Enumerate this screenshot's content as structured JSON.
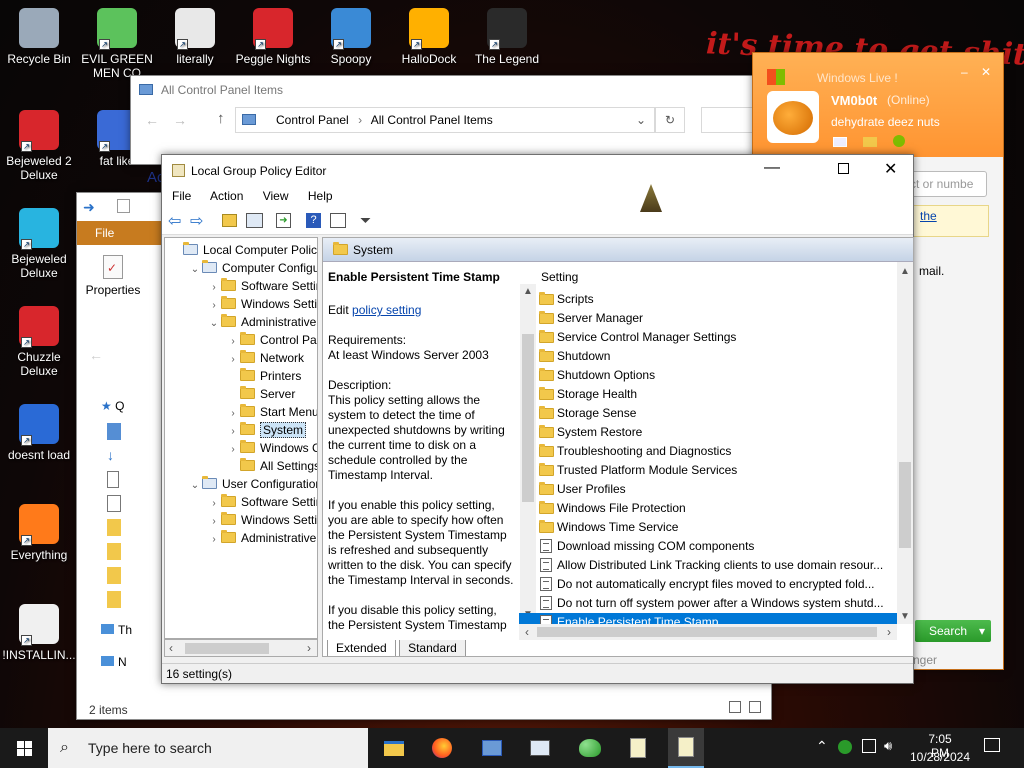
{
  "desktop": {
    "icons": [
      {
        "label": "Recycle Bin",
        "icon": "recycle-bin-icon"
      },
      {
        "label": "EVIL GREEN MEN CO",
        "icon": "green-men-icon"
      },
      {
        "label": "literally",
        "icon": "chrome-icon"
      },
      {
        "label": "Peggle Nights",
        "icon": "peggle-icon"
      },
      {
        "label": "Spoopy",
        "icon": "computers-icon"
      },
      {
        "label": "HalloDock",
        "icon": "hallodock-icon"
      },
      {
        "label": "The Legend",
        "icon": "legend-icon"
      },
      {
        "label": "Bejeweled 2 Deluxe",
        "icon": "bejeweled2-icon"
      },
      {
        "label": "fat like",
        "icon": "thunderbird-icon"
      },
      {
        "label": "Bejeweled Deluxe",
        "icon": "bejeweled-icon"
      },
      {
        "label": "Chuzzle Deluxe",
        "icon": "chuzzle-icon"
      },
      {
        "label": "doesnt load",
        "icon": "thunderbird-icon"
      },
      {
        "label": "Everything",
        "icon": "search-ring-icon"
      },
      {
        "label": "!INSTALLIN...",
        "icon": "text-file-icon"
      }
    ],
    "banner_text": "it's time to get shit"
  },
  "control_panel": {
    "title": "All Control Panel Items",
    "breadcrumb": [
      "Control Panel",
      "All Control Panel Items"
    ],
    "ac_text": "Ac"
  },
  "explorer": {
    "tab": "File",
    "ribbon_button": "Properties",
    "items_count": "2 items",
    "nav_q": "Q",
    "nav_th": "Th",
    "nav_n": "N"
  },
  "messenger": {
    "title": "Windows Live !",
    "user": "VM0b0t",
    "status": "(Online)",
    "mood": "dehydrate deez nuts",
    "search_placeholder": "ct or numbe",
    "link": "the",
    "mail": "mail.",
    "search_btn": "Search",
    "footer": "nger"
  },
  "gpedit": {
    "title": "Local Group Policy Editor",
    "menu": [
      "File",
      "Action",
      "View",
      "Help"
    ],
    "tree": [
      {
        "label": "Local Computer Policy",
        "level": 0,
        "arrow": ""
      },
      {
        "label": "Computer Configura",
        "level": 1,
        "arrow": "v"
      },
      {
        "label": "Software Settings",
        "level": 2,
        "arrow": ">"
      },
      {
        "label": "Windows Setting",
        "level": 2,
        "arrow": ">"
      },
      {
        "label": "Administrative Te",
        "level": 2,
        "arrow": "v"
      },
      {
        "label": "Control Panel",
        "level": 3,
        "arrow": ">"
      },
      {
        "label": "Network",
        "level": 3,
        "arrow": ">"
      },
      {
        "label": "Printers",
        "level": 3,
        "arrow": ""
      },
      {
        "label": "Server",
        "level": 3,
        "arrow": ""
      },
      {
        "label": "Start Menu ar",
        "level": 3,
        "arrow": ">"
      },
      {
        "label": "System",
        "level": 3,
        "arrow": ">",
        "selected": true
      },
      {
        "label": "Windows Cor",
        "level": 3,
        "arrow": ">"
      },
      {
        "label": "All Settings",
        "level": 3,
        "arrow": ""
      },
      {
        "label": "User Configuration",
        "level": 1,
        "arrow": "v"
      },
      {
        "label": "Software Settings",
        "level": 2,
        "arrow": ">"
      },
      {
        "label": "Windows Setting",
        "level": 2,
        "arrow": ">"
      },
      {
        "label": "Administrative Te",
        "level": 2,
        "arrow": ">"
      }
    ],
    "header": "System",
    "detail": {
      "title": "Enable Persistent Time Stamp",
      "edit_prefix": "Edit ",
      "edit_link": "policy setting",
      "req_label": "Requirements:",
      "req_value": "At least Windows Server 2003",
      "desc_label": "Description:",
      "desc": "This policy setting allows the system to detect the time of unexpected shutdowns by writing the current time to disk on a schedule controlled by the Timestamp Interval.",
      "enable": "If you enable this policy setting, you are able to specify how often the Persistent System Timestamp is refreshed and subsequently written to the disk. You can specify the Timestamp Interval in seconds.",
      "disable": "If you disable this policy setting, the Persistent System Timestamp"
    },
    "col_header": "Setting",
    "settings": [
      {
        "label": "Scripts",
        "type": "folder"
      },
      {
        "label": "Server Manager",
        "type": "folder"
      },
      {
        "label": "Service Control Manager Settings",
        "type": "folder"
      },
      {
        "label": "Shutdown",
        "type": "folder"
      },
      {
        "label": "Shutdown Options",
        "type": "folder"
      },
      {
        "label": "Storage Health",
        "type": "folder"
      },
      {
        "label": "Storage Sense",
        "type": "folder"
      },
      {
        "label": "System Restore",
        "type": "folder"
      },
      {
        "label": "Troubleshooting and Diagnostics",
        "type": "folder"
      },
      {
        "label": "Trusted Platform Module Services",
        "type": "folder"
      },
      {
        "label": "User Profiles",
        "type": "folder"
      },
      {
        "label": "Windows File Protection",
        "type": "folder"
      },
      {
        "label": "Windows Time Service",
        "type": "folder"
      },
      {
        "label": "Download missing COM components",
        "type": "policy"
      },
      {
        "label": "Allow Distributed Link Tracking clients to use domain resour...",
        "type": "policy"
      },
      {
        "label": "Do not automatically encrypt files moved to encrypted fold...",
        "type": "policy"
      },
      {
        "label": "Do not turn off system power after a Windows system shutd...",
        "type": "policy"
      },
      {
        "label": "Enable Persistent Time Stamp",
        "type": "policy",
        "selected": true
      }
    ],
    "tabs": [
      "Extended",
      "Standard"
    ],
    "status": "16 setting(s)"
  },
  "taskbar": {
    "search_placeholder": "Type here to search",
    "time": "7:05 PM",
    "date": "10/28/2024"
  },
  "colors": {
    "select": "#0078d7",
    "accent": "#ff8c1a",
    "taskbar": "#1a1a1a"
  }
}
